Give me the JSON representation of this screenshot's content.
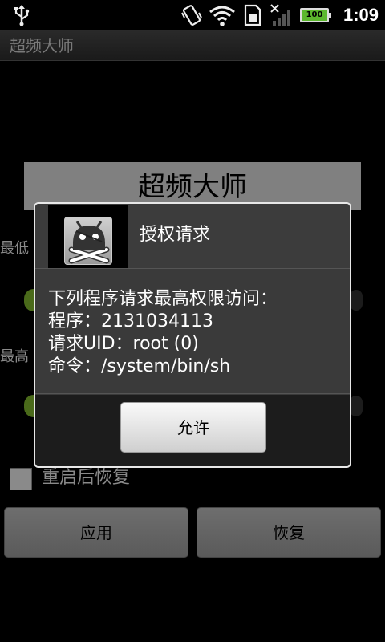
{
  "status_bar": {
    "battery_level": "100",
    "time": "1:09",
    "icons": [
      "usb-icon",
      "vibrate-icon",
      "wifi-icon",
      "sim-icon",
      "signal-off-icon",
      "battery-icon"
    ]
  },
  "app_bar": {
    "title": "超频大师"
  },
  "background": {
    "header": "超频大师",
    "label_min": "最低",
    "label_max": "最高",
    "checkbox_label": "重启后恢复",
    "checkbox_checked": false,
    "apply_button": "应用",
    "restore_button": "恢复"
  },
  "dialog": {
    "title": "授权请求",
    "icon": "superuser-pirate-icon",
    "lines": [
      "下列程序请求最高权限访问：",
      "程序：2131034113",
      "请求UID：root (0)",
      "命令：/system/bin/sh"
    ],
    "allow_button": "允许"
  }
}
